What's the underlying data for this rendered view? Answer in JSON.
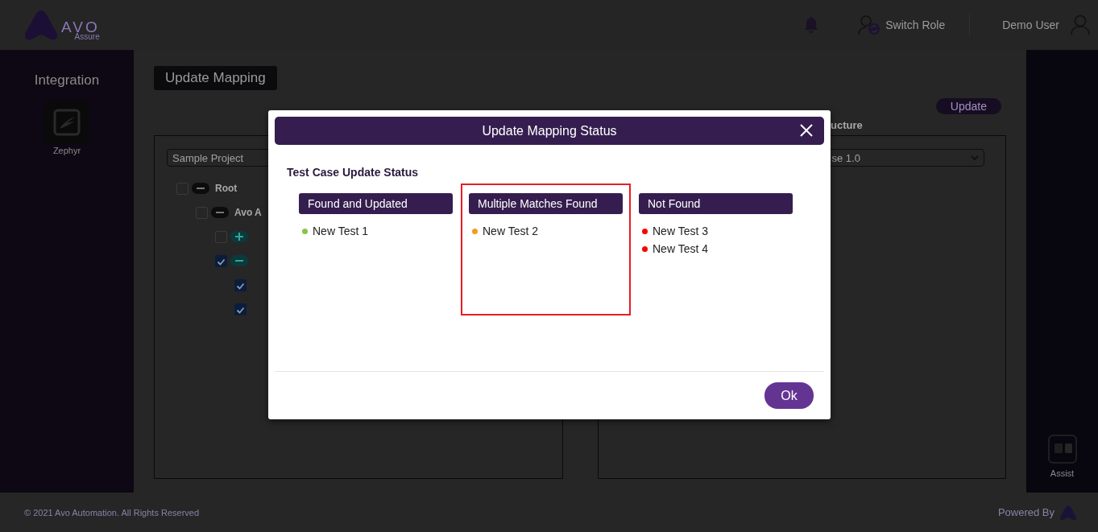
{
  "header": {
    "logo_text": "AVO",
    "logo_subtext": "Assure",
    "switch_role": "Switch Role",
    "user_name": "Demo User"
  },
  "sidebar": {
    "title": "Integration",
    "items": [
      {
        "label": "Zephyr"
      }
    ]
  },
  "main": {
    "update_mapping_button": "Update Mapping",
    "update_button": "Update",
    "right_heading": "ucture",
    "left_select": {
      "value": "Sample Project"
    },
    "right_select": {
      "value": "se 1.0"
    },
    "tree": [
      {
        "label": "Root",
        "checked": false,
        "expanded": true,
        "children": [
          {
            "label": "Avo A",
            "checked": false,
            "expanded": true,
            "children": [
              {
                "checked": false,
                "expanded": false
              },
              {
                "checked": true,
                "expanded": true,
                "children": [
                  {
                    "checked": true
                  },
                  {
                    "checked": true
                  }
                ]
              }
            ]
          }
        ]
      }
    ]
  },
  "assist": {
    "label": "Assist"
  },
  "footer": {
    "copyright": "© 2021 Avo Automation. All Rights Reserved",
    "powered_by": "Powered By"
  },
  "modal": {
    "title": "Update Mapping Status",
    "section_title": "Test Case Update Status",
    "ok_button": "Ok",
    "columns": [
      {
        "title": "Found and Updated",
        "highlighted": false,
        "items": [
          {
            "label": "New Test 1",
            "color": "#8bc34a"
          }
        ]
      },
      {
        "title": "Multiple Matches Found",
        "highlighted": true,
        "items": [
          {
            "label": "New Test 2",
            "color": "#f39c1f"
          }
        ]
      },
      {
        "title": "Not Found",
        "highlighted": false,
        "items": [
          {
            "label": "New Test 3",
            "color": "#ff0000"
          },
          {
            "label": "New Test 4",
            "color": "#ff0000"
          }
        ]
      }
    ]
  }
}
